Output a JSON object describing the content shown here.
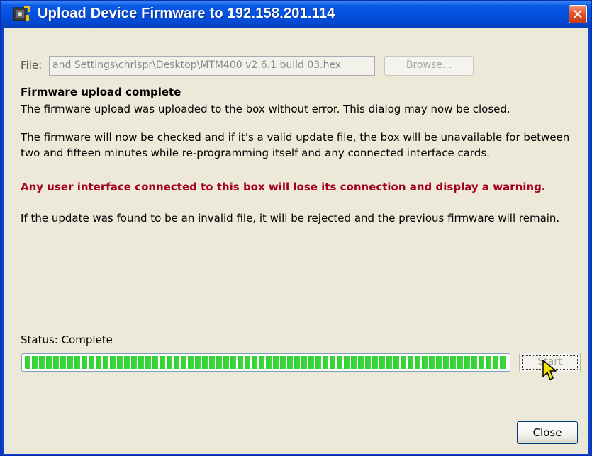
{
  "window": {
    "title": "Upload Device Firmware to 192.158.201.114",
    "close_glyph": "✕",
    "icons": {
      "app": "firmware-app-icon",
      "close": "close-icon"
    }
  },
  "file": {
    "label": "File:",
    "value": "and Settings\\chrispr\\Desktop\\MTM400 v2.6.1 build 03.hex",
    "browse_label": "Browse..."
  },
  "message": {
    "heading": "Firmware upload complete",
    "line1": "The firmware upload was uploaded to the box without error. This dialog may now be closed.",
    "line2": "The firmware will now be checked and if it's a valid update file, the box will be unavailable for between two and fifteen minutes while re-programming itself and any connected interface cards.",
    "warning": "Any user interface connected to this box will lose its connection and display a warning.",
    "line3": "If the update was found to be an invalid file, it will be rejected and the previous firmware will remain."
  },
  "status": {
    "label": "Status: Complete",
    "progress_percent": 100
  },
  "buttons": {
    "start_label": "Start",
    "close_label": "Close"
  },
  "colors": {
    "warning": "#a4001a",
    "progress": "#2fd12f",
    "titlebar": "#0551e0"
  }
}
